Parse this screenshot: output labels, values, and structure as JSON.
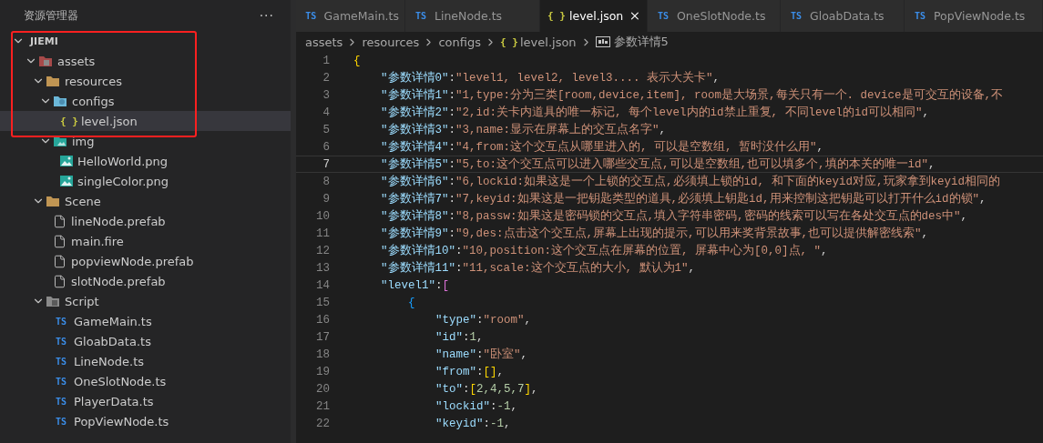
{
  "sidebar": {
    "title": "资源管理器",
    "more": "···",
    "tree": [
      {
        "label": "JIEMI",
        "kind": "root",
        "expanded": true,
        "children": [
          {
            "label": "assets",
            "kind": "assets",
            "expanded": true,
            "children": [
              {
                "label": "resources",
                "kind": "folder",
                "expanded": true,
                "children": [
                  {
                    "label": "configs",
                    "kind": "config",
                    "expanded": true,
                    "children": [
                      {
                        "label": "level.json",
                        "kind": "json",
                        "icon_text": "{ }",
                        "selected": true
                      }
                    ]
                  },
                  {
                    "label": "img",
                    "kind": "image-folder",
                    "expanded": true,
                    "children": [
                      {
                        "label": "HelloWorld.png",
                        "kind": "image",
                        "selected": false
                      },
                      {
                        "label": "singleColor.png",
                        "kind": "image",
                        "selected": false
                      }
                    ]
                  }
                ]
              },
              {
                "label": "Scene",
                "kind": "folder",
                "expanded": true,
                "children": [
                  {
                    "label": "lineNode.prefab",
                    "kind": "file",
                    "selected": false
                  },
                  {
                    "label": "main.fire",
                    "kind": "file",
                    "selected": false
                  },
                  {
                    "label": "popviewNode.prefab",
                    "kind": "file",
                    "selected": false
                  },
                  {
                    "label": "slotNode.prefab",
                    "kind": "file",
                    "selected": false
                  }
                ]
              },
              {
                "label": "Script",
                "kind": "script",
                "expanded": true,
                "children": [
                  {
                    "label": "GameMain.ts",
                    "kind": "ts",
                    "icon_text": "TS",
                    "selected": false
                  },
                  {
                    "label": "GloabData.ts",
                    "kind": "ts",
                    "icon_text": "TS",
                    "selected": false
                  },
                  {
                    "label": "LineNode.ts",
                    "kind": "ts",
                    "icon_text": "TS",
                    "selected": false
                  },
                  {
                    "label": "OneSlotNode.ts",
                    "kind": "ts",
                    "icon_text": "TS",
                    "selected": false
                  },
                  {
                    "label": "PlayerData.ts",
                    "kind": "ts",
                    "icon_text": "TS",
                    "selected": false
                  },
                  {
                    "label": "PopViewNode.ts",
                    "kind": "ts",
                    "icon_text": "TS",
                    "selected": false
                  }
                ]
              }
            ]
          }
        ]
      }
    ]
  },
  "tabs": [
    {
      "label": "GameMain.ts",
      "kind": "ts",
      "icon_text": "TS",
      "selected": false
    },
    {
      "label": "LineNode.ts",
      "kind": "ts",
      "icon_text": "TS",
      "selected": false
    },
    {
      "label": "level.json",
      "kind": "json",
      "icon_text": "{ }",
      "selected": true
    },
    {
      "label": "OneSlotNode.ts",
      "kind": "ts",
      "icon_text": "TS",
      "selected": false
    },
    {
      "label": "GloabData.ts",
      "kind": "ts",
      "icon_text": "TS",
      "selected": false
    },
    {
      "label": "PopViewNode.ts",
      "kind": "ts",
      "icon_text": "TS",
      "selected": false
    }
  ],
  "breadcrumbs": [
    {
      "label": "assets",
      "kind": "folder"
    },
    {
      "label": "resources",
      "kind": "folder"
    },
    {
      "label": "configs",
      "kind": "folder"
    },
    {
      "label": "level.json",
      "kind": "json",
      "icon_text": "{ }"
    },
    {
      "label": "参数详情5",
      "kind": "symbol"
    }
  ],
  "code": [
    {
      "number": "1",
      "kind": "root",
      "active": false,
      "tokens": [
        {
          "kind": "bracket1",
          "text": "{"
        }
      ]
    },
    {
      "number": "2",
      "kind": "property",
      "active": false,
      "tokens": [
        {
          "kind": "key",
          "text": "\"参数详情0\""
        },
        {
          "kind": "punct",
          "text": ":"
        },
        {
          "kind": "string",
          "text": "\"level1, level2, level3.... 表示大关卡\""
        },
        {
          "kind": "punct",
          "text": ","
        }
      ]
    },
    {
      "number": "3",
      "kind": "property",
      "active": false,
      "tokens": [
        {
          "kind": "key",
          "text": "\"参数详情1\""
        },
        {
          "kind": "punct",
          "text": ":"
        },
        {
          "kind": "string",
          "text": "\"1,type:分为三类[room,device,item], room是大场景,每关只有一个. device是可交互的设备,不"
        }
      ]
    },
    {
      "number": "4",
      "kind": "property",
      "active": false,
      "tokens": [
        {
          "kind": "key",
          "text": "\"参数详情2\""
        },
        {
          "kind": "punct",
          "text": ":"
        },
        {
          "kind": "string",
          "text": "\"2,id:关卡内道具的唯一标记, 每个level内的id禁止重复, 不同level的id可以相同\""
        },
        {
          "kind": "punct",
          "text": ","
        }
      ]
    },
    {
      "number": "5",
      "kind": "property",
      "active": false,
      "tokens": [
        {
          "kind": "key",
          "text": "\"参数详情3\""
        },
        {
          "kind": "punct",
          "text": ":"
        },
        {
          "kind": "string",
          "text": "\"3,name:显示在屏幕上的交互点名字\""
        },
        {
          "kind": "punct",
          "text": ","
        }
      ]
    },
    {
      "number": "6",
      "kind": "property",
      "active": false,
      "tokens": [
        {
          "kind": "key",
          "text": "\"参数详情4\""
        },
        {
          "kind": "punct",
          "text": ":"
        },
        {
          "kind": "string",
          "text": "\"4,from:这个交互点从哪里进入的, 可以是空数组, 暂时没什么用\""
        },
        {
          "kind": "punct",
          "text": ","
        }
      ]
    },
    {
      "number": "7",
      "kind": "property",
      "active": true,
      "tokens": [
        {
          "kind": "key",
          "text": "\"参数详情5\""
        },
        {
          "kind": "punct",
          "text": ":"
        },
        {
          "kind": "string",
          "text": "\"5,to:这个交互点可以进入哪些交互点,可以是空数组,也可以填多个,填的本关的唯一id\""
        },
        {
          "kind": "punct",
          "text": ","
        }
      ]
    },
    {
      "number": "8",
      "kind": "property",
      "active": false,
      "tokens": [
        {
          "kind": "key",
          "text": "\"参数详情6\""
        },
        {
          "kind": "punct",
          "text": ":"
        },
        {
          "kind": "string",
          "text": "\"6,lockid:如果这是一个上锁的交互点,必须填上锁的id, 和下面的keyid对应,玩家拿到keyid相同的"
        }
      ]
    },
    {
      "number": "9",
      "kind": "property",
      "active": false,
      "tokens": [
        {
          "kind": "key",
          "text": "\"参数详情7\""
        },
        {
          "kind": "punct",
          "text": ":"
        },
        {
          "kind": "string",
          "text": "\"7,keyid:如果这是一把钥匙类型的道具,必须填上钥匙id,用来控制这把钥匙可以打开什么id的锁\""
        },
        {
          "kind": "punct",
          "text": ","
        }
      ]
    },
    {
      "number": "10",
      "kind": "property",
      "active": false,
      "tokens": [
        {
          "kind": "key",
          "text": "\"参数详情8\""
        },
        {
          "kind": "punct",
          "text": ":"
        },
        {
          "kind": "string",
          "text": "\"8,passw:如果这是密码锁的交互点,填入字符串密码,密码的线索可以写在各处交互点的des中\""
        },
        {
          "kind": "punct",
          "text": ","
        }
      ]
    },
    {
      "number": "11",
      "kind": "property",
      "active": false,
      "tokens": [
        {
          "kind": "key",
          "text": "\"参数详情9\""
        },
        {
          "kind": "punct",
          "text": ":"
        },
        {
          "kind": "string",
          "text": "\"9,des:点击这个交互点,屏幕上出现的提示,可以用来奖背景故事,也可以提供解密线索\""
        },
        {
          "kind": "punct",
          "text": ","
        }
      ]
    },
    {
      "number": "12",
      "kind": "property",
      "active": false,
      "tokens": [
        {
          "kind": "key",
          "text": "\"参数详情10\""
        },
        {
          "kind": "punct",
          "text": ":"
        },
        {
          "kind": "string",
          "text": "\"10,position:这个交互点在屏幕的位置, 屏幕中心为[0,0]点, \""
        },
        {
          "kind": "punct",
          "text": ","
        }
      ]
    },
    {
      "number": "13",
      "kind": "property",
      "active": false,
      "tokens": [
        {
          "kind": "key",
          "text": "\"参数详情11\""
        },
        {
          "kind": "punct",
          "text": ":"
        },
        {
          "kind": "string",
          "text": "\"11,scale:这个交互点的大小, 默认为1\""
        },
        {
          "kind": "punct",
          "text": ","
        }
      ]
    },
    {
      "number": "14",
      "kind": "property",
      "active": false,
      "tokens": [
        {
          "kind": "key",
          "text": "\"level1\""
        },
        {
          "kind": "punct",
          "text": ":"
        },
        {
          "kind": "bracket2",
          "text": "["
        }
      ]
    },
    {
      "number": "15",
      "kind": "item",
      "active": false,
      "tokens": [
        {
          "kind": "bracket3",
          "text": "{"
        }
      ]
    },
    {
      "number": "16",
      "kind": "field",
      "active": false,
      "tokens": [
        {
          "kind": "key",
          "text": "\"type\""
        },
        {
          "kind": "punct",
          "text": ":"
        },
        {
          "kind": "string",
          "text": "\"room\""
        },
        {
          "kind": "punct",
          "text": ","
        }
      ]
    },
    {
      "number": "17",
      "kind": "field",
      "active": false,
      "tokens": [
        {
          "kind": "key",
          "text": "\"id\""
        },
        {
          "kind": "punct",
          "text": ":"
        },
        {
          "kind": "number",
          "text": "1"
        },
        {
          "kind": "punct",
          "text": ","
        }
      ]
    },
    {
      "number": "18",
      "kind": "field",
      "active": false,
      "tokens": [
        {
          "kind": "key",
          "text": "\"name\""
        },
        {
          "kind": "punct",
          "text": ":"
        },
        {
          "kind": "string",
          "text": "\"卧室\""
        },
        {
          "kind": "punct",
          "text": ","
        }
      ]
    },
    {
      "number": "19",
      "kind": "field",
      "active": false,
      "tokens": [
        {
          "kind": "key",
          "text": "\"from\""
        },
        {
          "kind": "punct",
          "text": ":"
        },
        {
          "kind": "bracket1",
          "text": "[]"
        },
        {
          "kind": "punct",
          "text": ","
        }
      ]
    },
    {
      "number": "20",
      "kind": "field",
      "active": false,
      "tokens": [
        {
          "kind": "key",
          "text": "\"to\""
        },
        {
          "kind": "punct",
          "text": ":"
        },
        {
          "kind": "bracket1",
          "text": "["
        },
        {
          "kind": "number",
          "text": "2,4,5,7"
        },
        {
          "kind": "bracket1",
          "text": "]"
        },
        {
          "kind": "punct",
          "text": ","
        }
      ]
    },
    {
      "number": "21",
      "kind": "field",
      "active": false,
      "tokens": [
        {
          "kind": "key",
          "text": "\"lockid\""
        },
        {
          "kind": "punct",
          "text": ":"
        },
        {
          "kind": "number",
          "text": "-1"
        },
        {
          "kind": "punct",
          "text": ","
        }
      ]
    },
    {
      "number": "22",
      "kind": "field",
      "active": false,
      "tokens": [
        {
          "kind": "key",
          "text": "\"keyid\""
        },
        {
          "kind": "punct",
          "text": ":"
        },
        {
          "kind": "number",
          "text": "-1"
        },
        {
          "kind": "punct",
          "text": ","
        }
      ]
    }
  ]
}
